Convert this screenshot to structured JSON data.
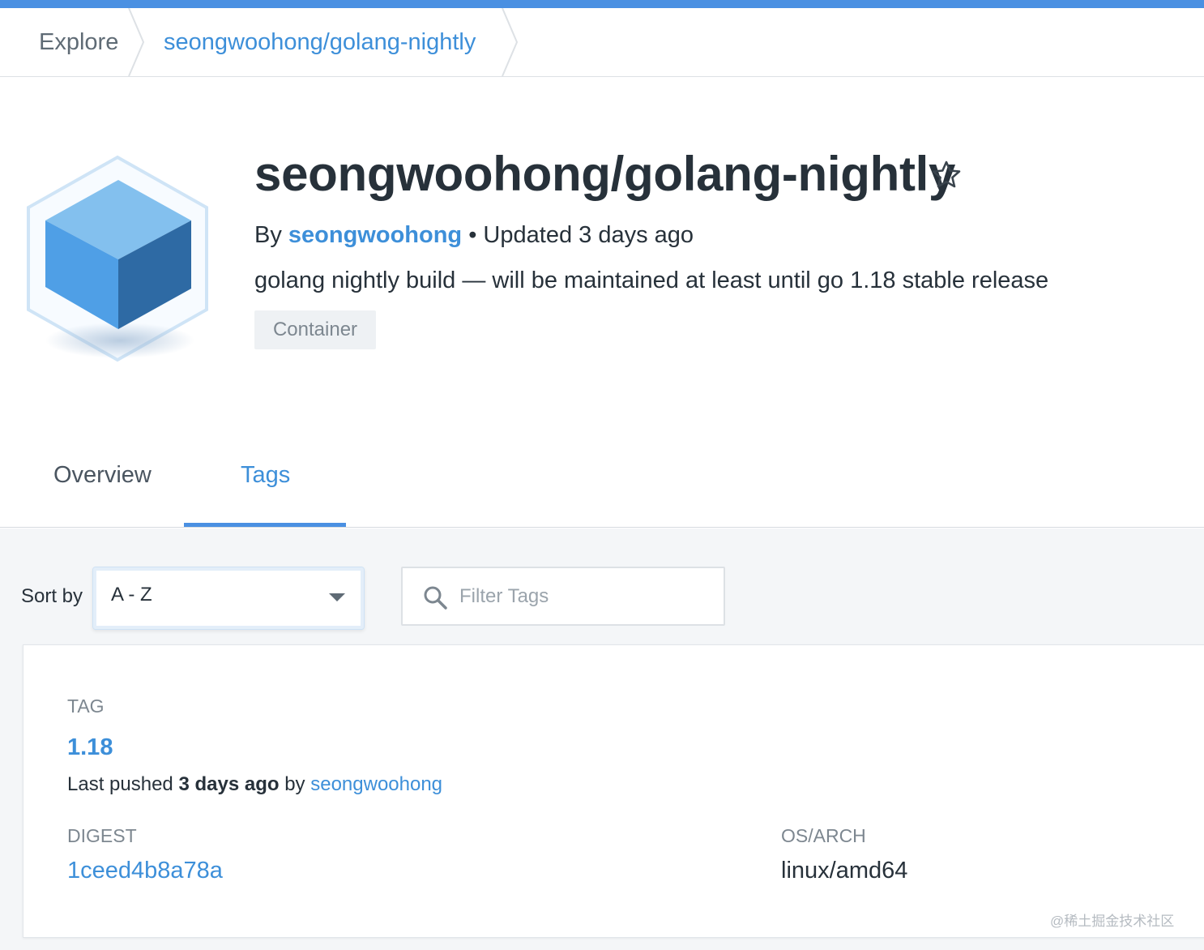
{
  "breadcrumb": {
    "explore": "Explore",
    "repo": "seongwoohong/golang-nightly"
  },
  "repo": {
    "title": "seongwoohong/golang-nightly",
    "by_prefix": "By",
    "author": "seongwoohong",
    "updated": "• Updated 3 days ago",
    "description": "golang nightly build — will be maintained at least until go 1.18 stable release",
    "badge": "Container",
    "icon": "cube-icon",
    "star_icon": "star-outline-icon"
  },
  "tabs": [
    {
      "label": "Overview",
      "active": false
    },
    {
      "label": "Tags",
      "active": true
    }
  ],
  "toolbar": {
    "sort_label": "Sort by",
    "sort_value": "A - Z",
    "filter_placeholder": "Filter Tags"
  },
  "tag_card": {
    "tag_header": "TAG",
    "tag": "1.18",
    "pushed_prefix": "Last pushed",
    "pushed_time": "3 days ago",
    "pushed_by": "by",
    "pushed_user": "seongwoohong",
    "digest_header": "DIGEST",
    "digest": "1ceed4b8a78a",
    "os_header": "OS/ARCH",
    "os_arch": "linux/amd64"
  },
  "watermark": "@稀土掘金技术社区",
  "colors": {
    "accent": "#4a90e2",
    "link": "#3d8fd9",
    "text": "#27313a",
    "muted": "#7d8790",
    "background": "#f4f6f8"
  }
}
